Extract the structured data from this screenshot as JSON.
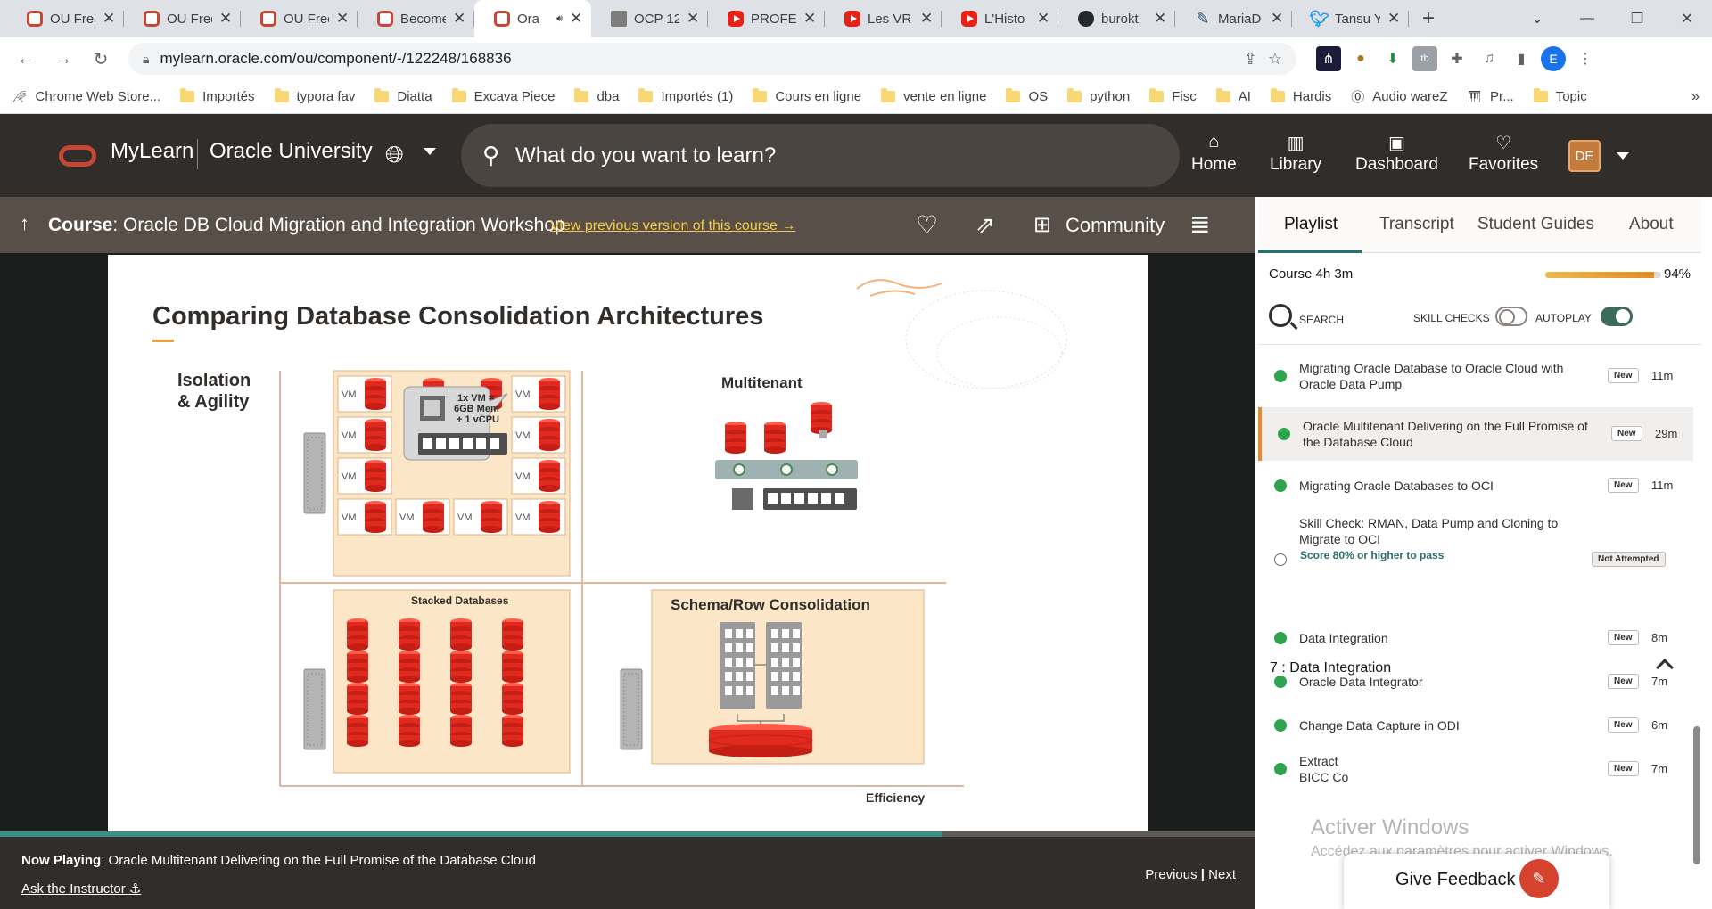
{
  "browser": {
    "tabs": [
      {
        "title": "OU Free",
        "icon": "oracle"
      },
      {
        "title": "OU Free",
        "icon": "oracle"
      },
      {
        "title": "OU Free",
        "icon": "oracle"
      },
      {
        "title": "Become",
        "icon": "oracle"
      },
      {
        "title": "Ora",
        "icon": "oracle",
        "active": true
      },
      {
        "title": "OCP 12",
        "icon": "ocp"
      },
      {
        "title": "PROFES",
        "icon": "yt"
      },
      {
        "title": "Les VR",
        "icon": "yt"
      },
      {
        "title": "L'Histo",
        "icon": "yt"
      },
      {
        "title": "burokt",
        "icon": "gh"
      },
      {
        "title": "MariaD",
        "icon": "maria"
      },
      {
        "title": "Tansu Y",
        "icon": "tw"
      }
    ],
    "url": "mylearn.oracle.com/ou/component/-/122248/168836",
    "profile_initial": "E",
    "bookmarks": [
      "Chrome Web Store...",
      "Importés",
      "typora fav",
      "Diatta",
      "Excava Piece",
      "dba",
      "Importés (1)",
      "Cours en ligne",
      "vente en ligne",
      "OS",
      "python",
      "Fisc",
      "AI",
      "Hardis",
      "Audio wareZ",
      "Pr...",
      "Topic"
    ]
  },
  "header": {
    "brand": "MyLearn",
    "org": "Oracle University",
    "search_placeholder": "What do you want to learn?",
    "nav": [
      {
        "label": "Home",
        "icon": "home-icon"
      },
      {
        "label": "Library",
        "icon": "library-icon"
      },
      {
        "label": "Dashboard",
        "icon": "dashboard-icon"
      },
      {
        "label": "Favorites",
        "icon": "heart-icon"
      }
    ],
    "user_initials": "DE"
  },
  "coursebar": {
    "prefix": "Course",
    "title": ": Oracle DB Cloud Migration and Integration Workshop",
    "previous_link": "View previous version of this course",
    "community": "Community"
  },
  "slide": {
    "title": "Comparing Database Consolidation Architectures",
    "y_axis": "Isolation & Agility",
    "x_axis": "Efficiency",
    "vm_label": "VM",
    "callout": [
      "1x VM =",
      "6GB Mem",
      "+ 1 vCPU"
    ],
    "multitenant": "Multitenant",
    "stacked": "Stacked Databases",
    "schema": "Schema/Row Consolidation"
  },
  "player": {
    "progress": 0.75,
    "now_playing_label": "Now Playing",
    "now_playing_title": ": Oracle Multitenant Delivering on the Full Promise of the Database Cloud",
    "ask_instructor": "Ask the Instructor",
    "previous": "Previous",
    "separator": "|",
    "next": "Next"
  },
  "panel": {
    "tabs": [
      "Playlist",
      "Transcript",
      "Student Guides",
      "About"
    ],
    "course_label": "Course",
    "course_duration": "4h 3m",
    "course_progress": 0.94,
    "course_percent": "94%",
    "search": "SEARCH",
    "skill_checks": "SKILL CHECKS",
    "autoplay": "AUTOPLAY",
    "items": [
      {
        "title": "Migrating Oracle Database to Oracle Cloud with Oracle Data Pump",
        "badge": "New",
        "duration": "11m"
      },
      {
        "title": "Oracle Multitenant Delivering on the Full Promise of the Database Cloud",
        "badge": "New",
        "duration": "29m"
      },
      {
        "title": "Migrating Oracle Databases to OCI",
        "badge": "New",
        "duration": "11m"
      },
      {
        "title": "Skill Check: RMAN, Data Pump and Cloning to Migrate to OCI",
        "badge": "Not Attempted",
        "duration": "",
        "note": "Score 80% or higher to pass"
      },
      {
        "title": "Data Integration",
        "badge": "New",
        "duration": "8m"
      },
      {
        "title": "Oracle Data Integrator",
        "badge": "New",
        "duration": "7m"
      },
      {
        "title": "Change Data Capture in ODI",
        "badge": "New",
        "duration": "6m"
      },
      {
        "title": "Extract",
        "title2": "BICC Co",
        "badge": "New",
        "duration": "7m"
      }
    ],
    "section": "7 : Data Integration",
    "feedback": "Give Feedback"
  },
  "os": {
    "watermark_title": "Activer Windows",
    "watermark_sub": "Accédez aux paramètres pour activer Windows."
  },
  "colors": {
    "oracle_red": "#c74634",
    "header_bg": "#312d2a",
    "db_red": "#e0291f",
    "accent_teal": "#2d6d6a",
    "accent_orange": "#e58c26"
  }
}
